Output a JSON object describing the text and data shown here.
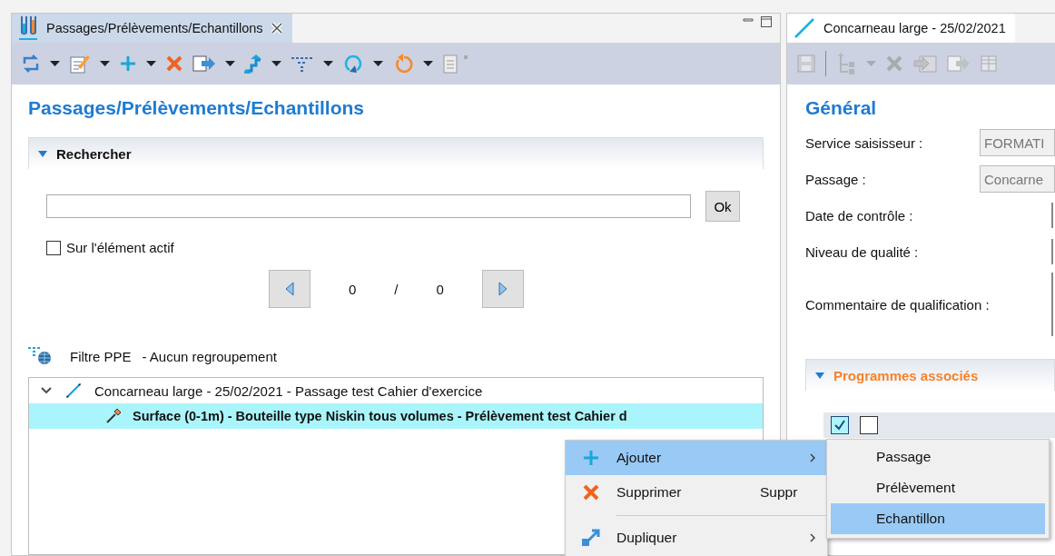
{
  "left_panel": {
    "tab": {
      "title": "Passages/Prélèvements/Echantillons",
      "closable": true
    },
    "toolbar": [
      {
        "kind": "sync",
        "dropdown": true
      },
      {
        "kind": "edit",
        "dropdown": true
      },
      {
        "kind": "add",
        "dropdown": true
      },
      {
        "kind": "delete",
        "dropdown": false
      },
      {
        "kind": "export",
        "dropdown": true
      },
      {
        "kind": "steps",
        "dropdown": true
      },
      {
        "kind": "filter",
        "dropdown": true
      },
      {
        "kind": "refresh",
        "dropdown": true
      },
      {
        "kind": "undo",
        "dropdown": true
      },
      {
        "kind": "notes",
        "dropdown": false
      }
    ],
    "heading": "Passages/Prélèvements/Echantillons",
    "search": {
      "title": "Rechercher",
      "expanded": true,
      "ok_button": "Ok",
      "active_element": {
        "label": "Sur l'élément actif",
        "checked": false
      },
      "pager": {
        "current": "0",
        "separator": "/",
        "total": "0"
      }
    },
    "filter": {
      "label": "Filtre PPE",
      "grouping": "- Aucun regroupement"
    },
    "tree": [
      {
        "label": "Concarneau large - 25/02/2021 - Passage test Cahier d'exercice",
        "kind": "passage",
        "expanded": true,
        "selected": false,
        "children": [
          {
            "label": "Surface (0-1m) - Bouteille type Niskin tous volumes - Prélèvement test Cahier d",
            "kind": "prelevement",
            "selected": true
          }
        ]
      }
    ]
  },
  "right_panel": {
    "tab": {
      "title": "Concarneau large - 25/02/2021"
    },
    "toolbar": [
      {
        "kind": "save",
        "disabled": true
      },
      {
        "kind": "separator"
      },
      {
        "kind": "tree-add",
        "disabled": true,
        "dropdown": true
      },
      {
        "kind": "delete",
        "disabled": true
      },
      {
        "kind": "import",
        "disabled": true
      },
      {
        "kind": "export",
        "disabled": true
      },
      {
        "kind": "grid",
        "disabled": true
      }
    ],
    "heading": "Général",
    "fields": [
      {
        "label": "Service saisisseur :",
        "value": "FORMATI",
        "kind": "text",
        "disabled": true
      },
      {
        "label": "Passage :",
        "value": "Concarne",
        "kind": "text",
        "disabled": true
      },
      {
        "label": "Date de contrôle :",
        "kind": "text"
      },
      {
        "label": "Niveau de qualité :",
        "kind": "text"
      },
      {
        "label": "Commentaire de qualification :",
        "kind": "textarea"
      }
    ],
    "programmes": {
      "title": "Programmes associés",
      "expanded": true,
      "checkboxes": [
        {
          "checked": true
        },
        {
          "checked": false
        }
      ]
    }
  },
  "context_menu": {
    "items": [
      {
        "kind": "add",
        "label": "Ajouter",
        "submenu": true,
        "selected": true
      },
      {
        "kind": "delete",
        "label": "Supprimer",
        "shortcut": "Suppr",
        "selected": false
      },
      {
        "kind": "separator"
      },
      {
        "kind": "duplicate",
        "label": "Dupliquer",
        "submenu": true,
        "selected": false
      }
    ],
    "submenu": [
      {
        "label": "Passage",
        "selected": false
      },
      {
        "label": "Prélèvement",
        "selected": false
      },
      {
        "label": "Echantillon",
        "selected": true
      }
    ]
  }
}
